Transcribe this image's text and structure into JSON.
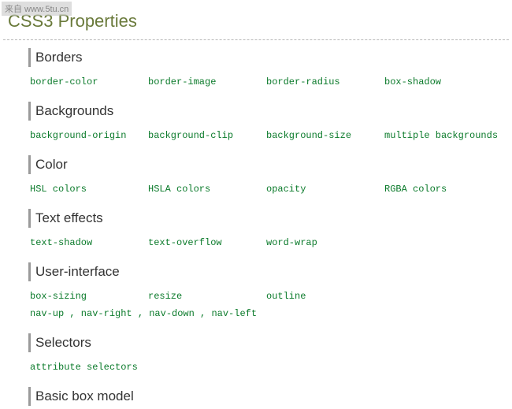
{
  "watermark": "来自 www.5tu.cn",
  "title": "CSS3 Properties",
  "sections": [
    {
      "heading": "Borders",
      "props": [
        "border-color",
        "border-image",
        "border-radius",
        "box-shadow"
      ]
    },
    {
      "heading": "Backgrounds",
      "props": [
        "background-origin",
        "background-clip",
        "background-size",
        "multiple backgrounds"
      ]
    },
    {
      "heading": "Color",
      "props": [
        "HSL colors",
        "HSLA colors",
        "opacity",
        "RGBA colors"
      ]
    },
    {
      "heading": "Text effects",
      "props": [
        "text-shadow",
        "text-overflow",
        "word-wrap"
      ]
    },
    {
      "heading": "User-interface",
      "props": [
        "box-sizing",
        "resize",
        "outline",
        "nav-up , nav-right , nav-down , nav-left"
      ]
    },
    {
      "heading": "Selectors",
      "props": [
        "attribute selectors"
      ]
    },
    {
      "heading": "Basic box model",
      "props": []
    }
  ]
}
